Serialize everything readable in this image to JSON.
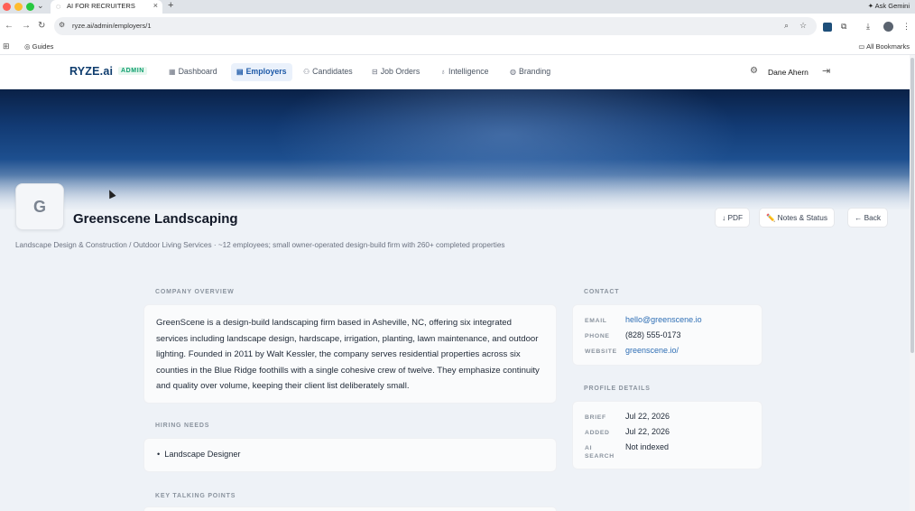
{
  "browser": {
    "tab_title": "AI FOR RECRUITERS",
    "new_tab": "+",
    "ask_gemini": "Ask Gemini",
    "url": "ryze.ai/admin/employers/1",
    "bookmark_guides": "Guides",
    "all_bookmarks": "All Bookmarks"
  },
  "app": {
    "brand": "RYZE.ai",
    "badge": "ADMIN",
    "nav": [
      {
        "label": "Dashboard",
        "icon": "grid-icon",
        "active": false
      },
      {
        "label": "Employers",
        "icon": "building-icon",
        "active": true
      },
      {
        "label": "Candidates",
        "icon": "users-icon",
        "active": false
      },
      {
        "label": "Job Orders",
        "icon": "briefcase-icon",
        "active": false
      },
      {
        "label": "Intelligence",
        "icon": "lightbulb-icon",
        "active": false
      },
      {
        "label": "Branding",
        "icon": "palette-icon",
        "active": false
      }
    ],
    "user_name": "Dane Ahern"
  },
  "profile": {
    "avatar_letter": "G",
    "name": "Greenscene Landscaping",
    "meta": "Landscape Design & Construction / Outdoor Living Services  · ~12 employees; small owner-operated design-build firm with 260+ completed properties",
    "actions": {
      "pdf": "↓ PDF",
      "notes": "✏️ Notes & Status",
      "back": "← Back"
    }
  },
  "overview": {
    "label": "COMPANY OVERVIEW",
    "text": "GreenScene is a design-build landscaping firm based in Asheville, NC, offering six integrated services including landscape design, hardscape, irrigation, planting, lawn maintenance, and outdoor lighting. Founded in 2011 by Walt Kessler, the company serves residential properties across six counties in the Blue Ridge foothills with a single cohesive crew of twelve. They emphasize continuity and quality over volume, keeping their client list deliberately small."
  },
  "hiring": {
    "label": "HIRING NEEDS",
    "items": [
      "Landscape Designer"
    ]
  },
  "talking_points": {
    "label": "KEY TALKING POINTS"
  },
  "contact": {
    "label": "CONTACT",
    "email_key": "EMAIL",
    "email": "hello@greenscene.io",
    "phone_key": "PHONE",
    "phone": "(828) 555-0173",
    "website_key": "WEBSITE",
    "website": "greenscene.io/"
  },
  "profile_details": {
    "label": "PROFILE DETAILS",
    "brief_key": "BRIEF",
    "brief": "Jul 22, 2026",
    "added_key": "ADDED",
    "added": "Jul 22, 2026",
    "ai_search_key": "AI SEARCH",
    "ai_search": "Not indexed"
  },
  "colors": {
    "brand": "#0f3d6e",
    "accent": "#1e5aa8",
    "link": "#2f6fb5",
    "admin_badge": "#0f9f6e"
  }
}
